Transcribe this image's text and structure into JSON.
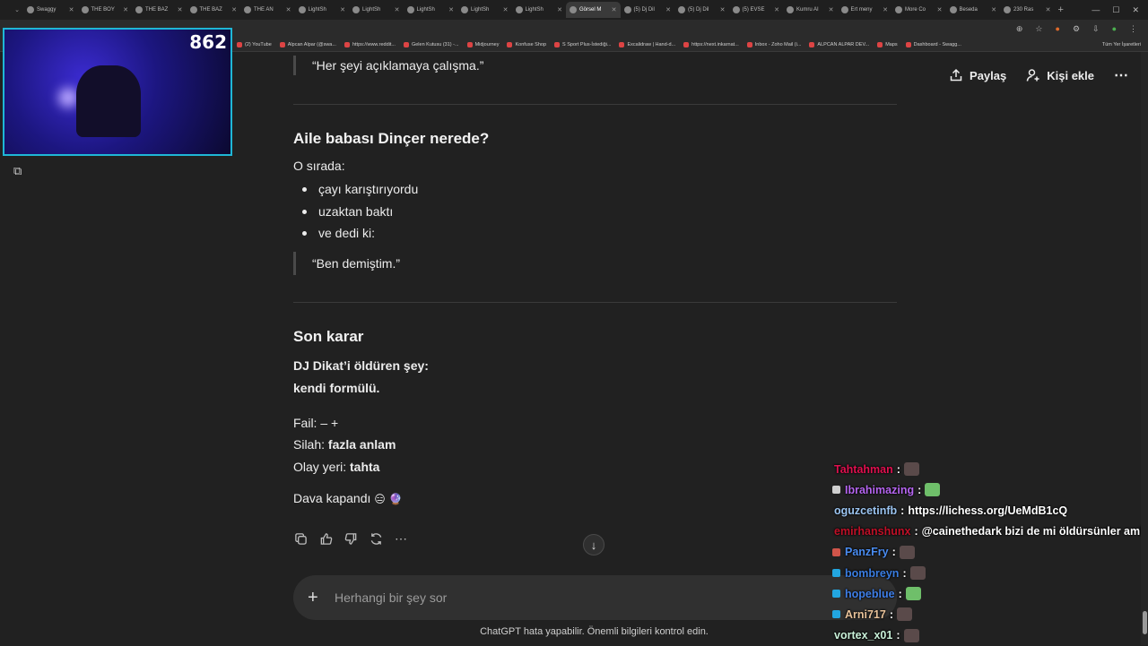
{
  "browser": {
    "tabs": [
      {
        "label": "Swaggy"
      },
      {
        "label": "THE BOY"
      },
      {
        "label": "THE BAZ"
      },
      {
        "label": "THE BAZ"
      },
      {
        "label": "THE AN"
      },
      {
        "label": "LightSh"
      },
      {
        "label": "LightSh"
      },
      {
        "label": "LightSh"
      },
      {
        "label": "LightSh"
      },
      {
        "label": "LightSh"
      },
      {
        "label": "Görsel M",
        "active": true
      },
      {
        "label": "(5) Dj Dil"
      },
      {
        "label": "(5) Dj Dil"
      },
      {
        "label": "(5) EVSE"
      },
      {
        "label": "Kumru AI"
      },
      {
        "label": "Ert meny"
      },
      {
        "label": "More Co"
      },
      {
        "label": "Beseda"
      },
      {
        "label": "230 Ras"
      }
    ],
    "new_tab": "+",
    "bookmarks": [
      {
        "label": "(2) YouTube"
      },
      {
        "label": "Alpcan Alpar (@swa..."
      },
      {
        "label": "https://www.reddit..."
      },
      {
        "label": "Gelen Kutusu (31) -..."
      },
      {
        "label": "Midjourney"
      },
      {
        "label": "Konfuse Shop"
      },
      {
        "label": "S Sport Plus-İstediği..."
      },
      {
        "label": "Excalidraw | Hand-d..."
      },
      {
        "label": "https://next.inkarnat..."
      },
      {
        "label": "Inbox - Zoho Mail (i..."
      },
      {
        "label": "ALPCAN ALPAR DEV..."
      },
      {
        "label": "Maps"
      },
      {
        "label": "Dashboard - Swagg..."
      }
    ],
    "all_bookmarks": "Tüm Yer İşaretleri"
  },
  "webcam": {
    "viewer_count": "862"
  },
  "header": {
    "share_label": "Paylaş",
    "add_person_label": "Kişi ekle",
    "more_label": "⋯"
  },
  "conversation": {
    "quote_top": "“Her şeyi açıklamaya çalışma.”",
    "section1_title": "Aile babası Dinçer nerede?",
    "section1_intro": "O sırada:",
    "section1_items": [
      "çayı karıştırıyordu",
      "uzaktan baktı",
      "ve dedi ki:"
    ],
    "section1_quote": "“Ben demiştim.”",
    "section2_title": "Son karar",
    "verdict_line1": "DJ Dikat’i öldüren şey:",
    "verdict_line2": "kendi formülü.",
    "fail_label": "Fail:",
    "fail_value": "– +",
    "weapon_label": "Silah:",
    "weapon_value": "fazla anlam",
    "scene_label": "Olay yeri:",
    "scene_value": "tahta",
    "closing": "Dava kapandı",
    "closing_emojis": "😑 🔮"
  },
  "composer": {
    "placeholder": "Herhangi bir şey sor",
    "plus": "+"
  },
  "footer": {
    "disclaimer": "ChatGPT hata yapabilir. Önemli bilgileri kontrol edin."
  },
  "stream_chat": [
    {
      "user": "Tahtahman",
      "color": "#e0104f",
      "text": ""
    },
    {
      "user": "Ibrahimazing",
      "color": "#b565f0",
      "text": ""
    },
    {
      "user": "oguzcetinfb",
      "color": "#9bc4f0",
      "text": "https://lichess.org/UeMdB1cQ"
    },
    {
      "user": "emirhanshunx",
      "color": "#c01028",
      "text": "@cainethedark bizi de mi öldürsünler amk"
    },
    {
      "user": "PanzFry",
      "color": "#4a8cf0",
      "text": ""
    },
    {
      "user": "bombreyn",
      "color": "#3a7de0",
      "text": ""
    },
    {
      "user": "hopeblue",
      "color": "#3f7fe8",
      "text": ""
    },
    {
      "user": "Arni717",
      "color": "#e8c29a",
      "text": ""
    },
    {
      "user": "vortex_x01",
      "color": "#c8f0d8",
      "text": ""
    }
  ]
}
